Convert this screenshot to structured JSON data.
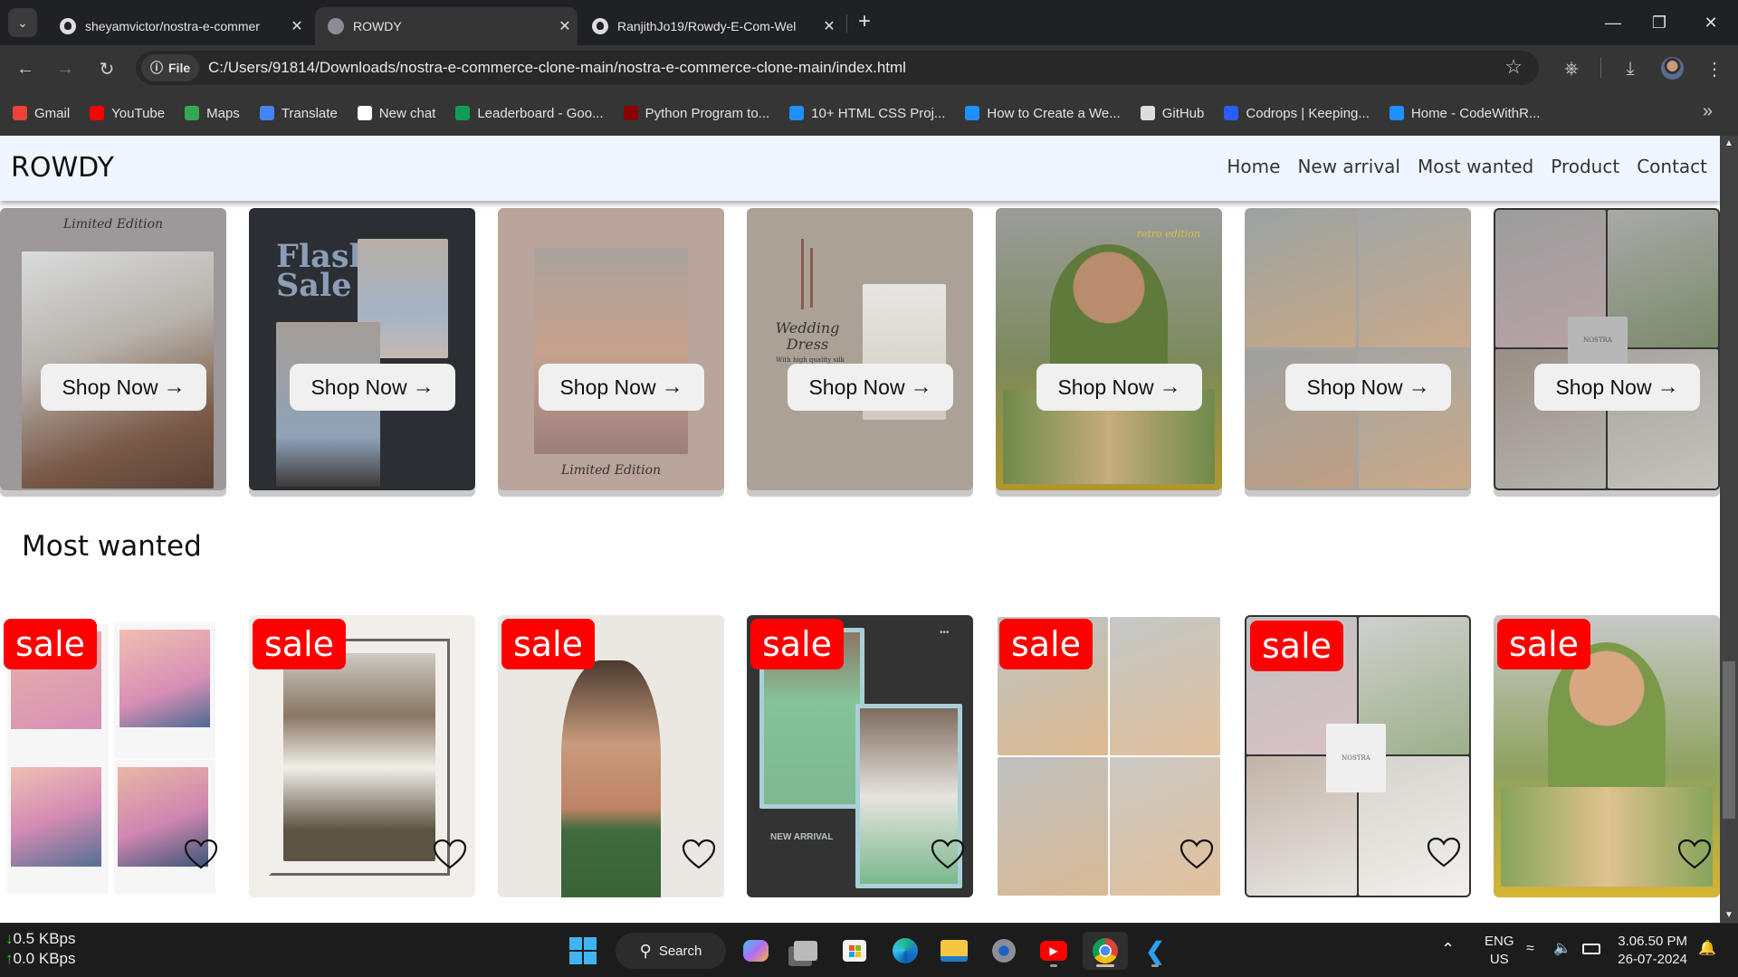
{
  "browser": {
    "tabs": [
      {
        "title": "sheyamvictor/nostra-e-commer",
        "icon": "github-icon",
        "active": false
      },
      {
        "title": "ROWDY",
        "icon": "globe-icon",
        "active": true
      },
      {
        "title": "RanjithJo19/Rowdy-E-Com-Wel",
        "icon": "github-icon",
        "active": false
      }
    ],
    "new_tab_label": "+",
    "address": {
      "chip_label": "File",
      "url": "C:/Users/91814/Downloads/nostra-e-commerce-clone-main/nostra-e-commerce-clone-main/index.html"
    },
    "bookmarks": [
      {
        "label": "Gmail",
        "icon": "gmail-icon",
        "color": "#ea4335"
      },
      {
        "label": "YouTube",
        "icon": "youtube-icon",
        "color": "#ff0000"
      },
      {
        "label": "Maps",
        "icon": "maps-icon",
        "color": "#34a853"
      },
      {
        "label": "Translate",
        "icon": "translate-icon",
        "color": "#4285f4"
      },
      {
        "label": "New chat",
        "icon": "chatgpt-icon",
        "color": "#ffffff"
      },
      {
        "label": "Leaderboard - Goo...",
        "icon": "sheets-icon",
        "color": "#0f9d58"
      },
      {
        "label": "Python Program to...",
        "icon": "tg-icon",
        "color": "#8b0000"
      },
      {
        "label": "10+ HTML CSS Proj...",
        "icon": "codewithr-icon",
        "color": "#1e90ff"
      },
      {
        "label": "How to Create a We...",
        "icon": "codewithr-icon",
        "color": "#1e90ff"
      },
      {
        "label": "GitHub",
        "icon": "github-icon",
        "color": "#dddddd"
      },
      {
        "label": "Codrops | Keeping...",
        "icon": "codrops-icon",
        "color": "#2b5cff"
      },
      {
        "label": "Home - CodeWithR...",
        "icon": "codewithr-icon",
        "color": "#1e90ff"
      }
    ],
    "bookmarks_overflow": "»"
  },
  "site": {
    "logo": "ROWDY",
    "nav": [
      "Home",
      "New arrival",
      "Most wanted",
      "Product",
      "Contact"
    ],
    "featured_cards": [
      {
        "theme": "Limited Edition portrait",
        "cta": "Shop Now"
      },
      {
        "theme": "Flash Sale",
        "cta": "Shop Now"
      },
      {
        "theme": "Clothing rack Limited Edition",
        "cta": "Shop Now"
      },
      {
        "theme": "Wedding Dress",
        "cta": "Shop Now"
      },
      {
        "theme": "Retro edition sunglasses",
        "cta": "Shop Now"
      },
      {
        "theme": "Scarf collage",
        "cta": "Shop Now"
      },
      {
        "theme": "Nostra collage",
        "cta": "Shop Now"
      }
    ],
    "featured_texts": {
      "limited_edition": "Limited Edition",
      "flash_sale": "Flash Sale",
      "wedding_dress": "Wedding Dress",
      "wedding_sub": "With high quality silk",
      "nostra": "NOSTRA",
      "retro": "retro edition"
    },
    "most_wanted_title": "Most wanted",
    "sale_badge": "sale",
    "most_wanted_cards": [
      {
        "theme": "Polaroid collage"
      },
      {
        "theme": "Knit scarf outfit"
      },
      {
        "theme": "Annotated selfie"
      },
      {
        "theme": "Green suit new arrival",
        "overlay_text": "NEW ARRIVAL"
      },
      {
        "theme": "Scarf collage"
      },
      {
        "theme": "Nostra collage",
        "overlay_text": "NOSTRA"
      },
      {
        "theme": "Retro sunglasses"
      }
    ]
  },
  "taskbar": {
    "net_down": "0.5 KBps",
    "net_up": "0.0 KBps",
    "search_label": "Search",
    "apps": [
      "copilot-icon",
      "task-view-icon",
      "store-icon",
      "edge-icon",
      "file-explorer-icon",
      "settings-icon",
      "youtube-icon",
      "chrome-icon",
      "vscode-icon"
    ],
    "lang_line1": "ENG",
    "lang_line2": "US",
    "time": "3.06.50 PM",
    "date": "26-07-2024"
  }
}
